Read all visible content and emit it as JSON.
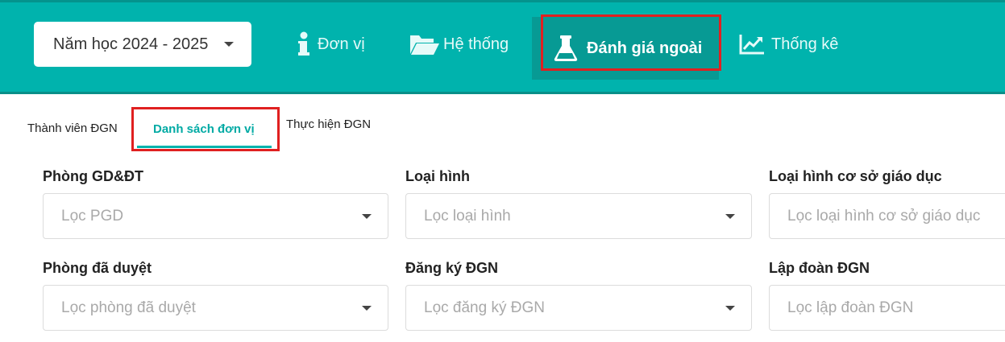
{
  "header": {
    "year_select": {
      "value": "Năm học 2024 - 2025",
      "icon": "caret-down-icon"
    },
    "nav": [
      {
        "label": "Đơn vị",
        "icon": "info-icon"
      },
      {
        "label": "Hệ thống",
        "icon": "folder-open-icon"
      },
      {
        "label": "Đánh giá ngoài",
        "icon": "flask-icon",
        "active": true
      },
      {
        "label": "Thống kê",
        "icon": "chart-line-icon"
      }
    ],
    "colors": {
      "bar": "#00b3ad",
      "active_tab": "#079a94",
      "highlight": "#e02020"
    }
  },
  "subtabs": [
    {
      "label": "Thành viên ĐGN"
    },
    {
      "label": "Danh sách đơn vị",
      "active": true
    },
    {
      "label": "Thực hiện ĐGN"
    }
  ],
  "filters": [
    {
      "label": "Phòng GD&ĐT",
      "placeholder": "Lọc PGD"
    },
    {
      "label": "Loại hình",
      "placeholder": "Lọc loại hình"
    },
    {
      "label": "Loại hình cơ sở giáo dục",
      "placeholder": "Lọc loại hình cơ sở giáo dục"
    },
    {
      "label": "Phòng đã duyệt",
      "placeholder": "Lọc phòng đã duyệt"
    },
    {
      "label": "Đăng ký ĐGN",
      "placeholder": "Lọc đăng ký ĐGN"
    },
    {
      "label": "Lập đoàn ĐGN",
      "placeholder": "Lọc lập đoàn ĐGN"
    }
  ]
}
